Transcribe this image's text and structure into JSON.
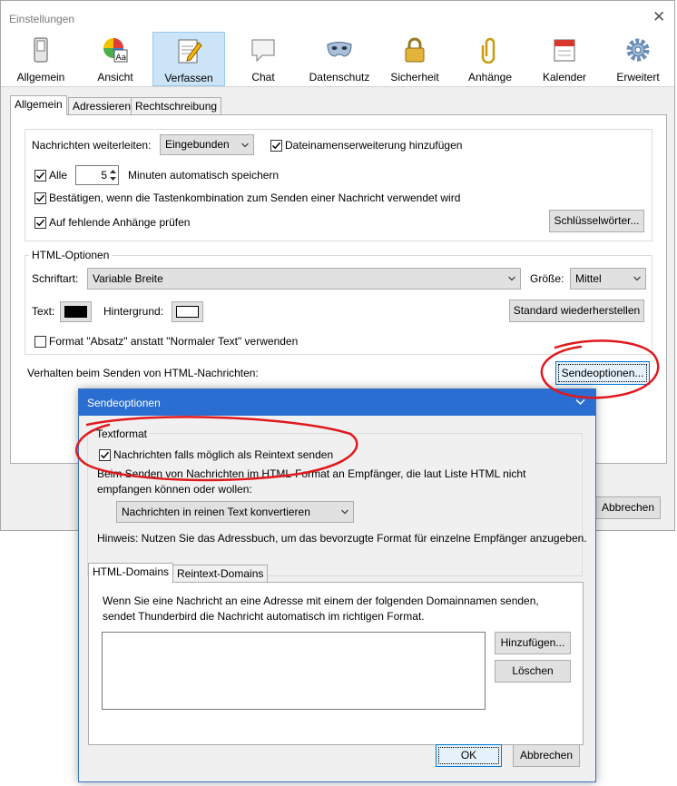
{
  "window": {
    "title": "Einstellungen"
  },
  "toolbar": {
    "items": [
      {
        "label": "Allgemein",
        "icon": "switch-icon"
      },
      {
        "label": "Ansicht",
        "icon": "color-palette-icon"
      },
      {
        "label": "Verfassen",
        "icon": "compose-pencil-icon"
      },
      {
        "label": "Chat",
        "icon": "chat-bubble-icon"
      },
      {
        "label": "Datenschutz",
        "icon": "mask-icon"
      },
      {
        "label": "Sicherheit",
        "icon": "padlock-icon"
      },
      {
        "label": "Anhänge",
        "icon": "paperclip-icon"
      },
      {
        "label": "Kalender",
        "icon": "calendar-icon"
      },
      {
        "label": "Erweitert",
        "icon": "gear-icon"
      }
    ],
    "selected": "Verfassen"
  },
  "tabs": [
    "Allgemein",
    "Adressieren",
    "Rechtschreibung"
  ],
  "general": {
    "forward_label": "Nachrichten weiterleiten:",
    "forward_value": "Eingebunden",
    "file_ext_label": "Dateinamenserweiterung hinzufügen",
    "file_ext_checked": true,
    "autosave_prefix": "Alle",
    "autosave_checked": true,
    "autosave_minutes": "5",
    "autosave_suffix": "Minuten automatisch speichern",
    "confirm_label": "Bestätigen, wenn die Tastenkombination zum Senden einer Nachricht verwendet wird",
    "confirm_checked": true,
    "attachments_label": "Auf fehlende Anhänge prüfen",
    "attachments_checked": true,
    "keywords_button": "Schlüsselwörter..."
  },
  "html_options": {
    "legend": "HTML-Optionen",
    "font_label": "Schriftart:",
    "font_value": "Variable Breite",
    "size_label": "Größe:",
    "size_value": "Mittel",
    "text_label": "Text:",
    "text_color": "#000000",
    "background_label": "Hintergrund:",
    "background_color": "#ffffff",
    "restore_button": "Standard wiederherstellen",
    "paragraph_label": "Format \"Absatz\" anstatt \"Normaler Text\" verwenden",
    "paragraph_checked": false
  },
  "send_behavior": {
    "label": "Verhalten beim Senden von HTML-Nachrichten:",
    "button": "Sendeoptionen..."
  },
  "main_cancel_button": "Abbrechen",
  "dialog": {
    "title": "Sendeoptionen",
    "textformat_legend": "Textformat",
    "plaintext_label": "Nachrichten falls möglich als Reintext senden",
    "plaintext_checked": true,
    "explanation": "Beim Senden von Nachrichten im HTML-Format an Empfänger, die laut Liste HTML nicht empfangen können oder wollen:",
    "convert_value": "Nachrichten in reinen Text konvertieren",
    "hint": "Hinweis: Nutzen Sie das Adressbuch, um das bevorzugte Format für einzelne Empfänger anzugeben.",
    "tabs": [
      "HTML-Domains",
      "Reintext-Domains"
    ],
    "domains_desc": "Wenn Sie eine Nachricht an eine Adresse mit einem der folgenden Domainnamen senden, sendet Thunderbird die Nachricht automatisch im richtigen Format.",
    "add_button": "Hinzufügen...",
    "delete_button": "Löschen",
    "ok_button": "OK",
    "cancel_button": "Abbrechen"
  },
  "annotation_color": "#e0191c"
}
